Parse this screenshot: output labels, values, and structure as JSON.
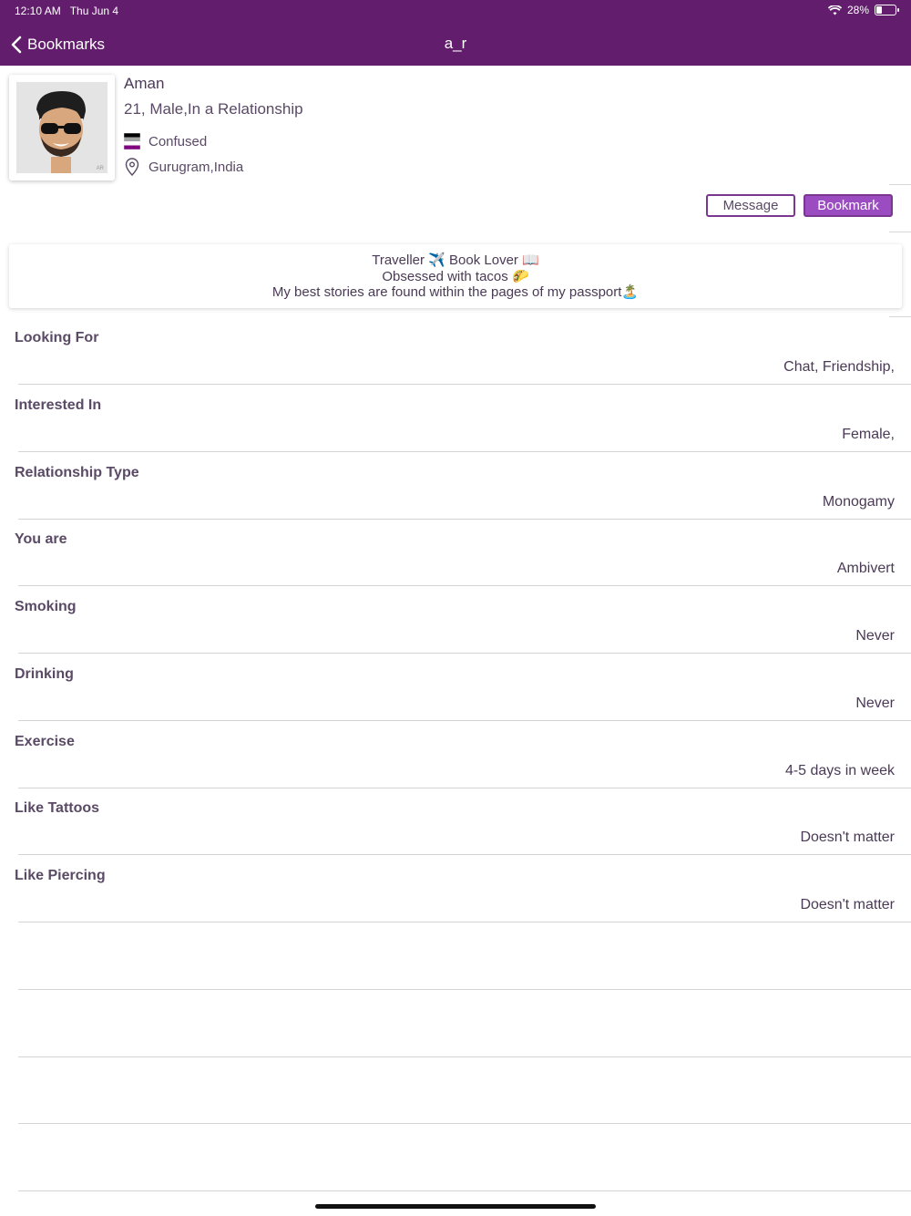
{
  "status_bar": {
    "time": "12:10 AM",
    "date": "Thu Jun 4",
    "battery": "28%",
    "battery_level": 0.28
  },
  "nav": {
    "back_label": "Bookmarks",
    "title": "a_r"
  },
  "profile": {
    "name": "Aman",
    "subinfo": "21, Male,In a Relationship",
    "orientation": "Confused",
    "location": "Gurugram,India",
    "avatar_watermark": "AR"
  },
  "actions": {
    "message_label": "Message",
    "bookmark_label": "Bookmark"
  },
  "bio": {
    "lines": [
      "Traveller ✈️ Book Lover 📖",
      "Obsessed with tacos 🌮",
      "My best stories are found within the pages of my passport🏝️"
    ]
  },
  "fields": [
    {
      "label": "Looking For",
      "value": "Chat, Friendship,"
    },
    {
      "label": "Interested In",
      "value": "Female,"
    },
    {
      "label": "Relationship Type",
      "value": "Monogamy"
    },
    {
      "label": "You are",
      "value": "Ambivert"
    },
    {
      "label": "Smoking",
      "value": "Never"
    },
    {
      "label": "Drinking",
      "value": "Never"
    },
    {
      "label": "Exercise",
      "value": "4-5 days in week"
    },
    {
      "label": "Like Tattoos",
      "value": "Doesn't matter"
    },
    {
      "label": "Like Piercing",
      "value": "Doesn't matter"
    }
  ],
  "colors": {
    "header": "#621e6c",
    "accent": "#9b4cc0",
    "text": "#4a3a55"
  }
}
